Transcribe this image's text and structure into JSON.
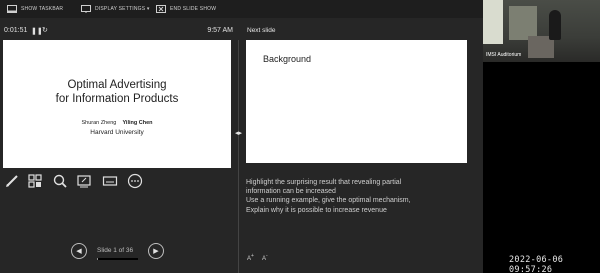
{
  "toolbar": {
    "show_taskbar": "SHOW TASKBAR",
    "display_settings": "DISPLAY SETTINGS ▾",
    "end_slide_show": "END SLIDE SHOW"
  },
  "presenter": {
    "timer": "0:01:51",
    "clock": "9:57 AM",
    "next_slide_label": "Next slide"
  },
  "current_slide": {
    "title_line1": "Optimal Advertising",
    "title_line2": "for Information Products",
    "author1": "Shuran Zheng",
    "author2": "Yiling Chen",
    "affiliation": "Harvard University"
  },
  "next_slide": {
    "title": "Background"
  },
  "notes": {
    "line1": "Highlight the surprising result that revealing partial",
    "line2": "information can be increased",
    "line3": "Use a running example, give the optimal mechanism,",
    "line4": "Explain why it is possible to increase revenue"
  },
  "navigation": {
    "slide_count": "Slide 1 of 36",
    "progress": 0.0278
  },
  "tools": [
    "pen-icon",
    "see-all-slides-icon",
    "zoom-icon",
    "pointer-icon",
    "subtitles-icon",
    "more-options-icon"
  ],
  "font_controls": {
    "grow": "A",
    "shrink": "A"
  },
  "webcam": {
    "label": "IMSI Auditorium"
  },
  "timestamp": "2022-06-06 09:57:26"
}
